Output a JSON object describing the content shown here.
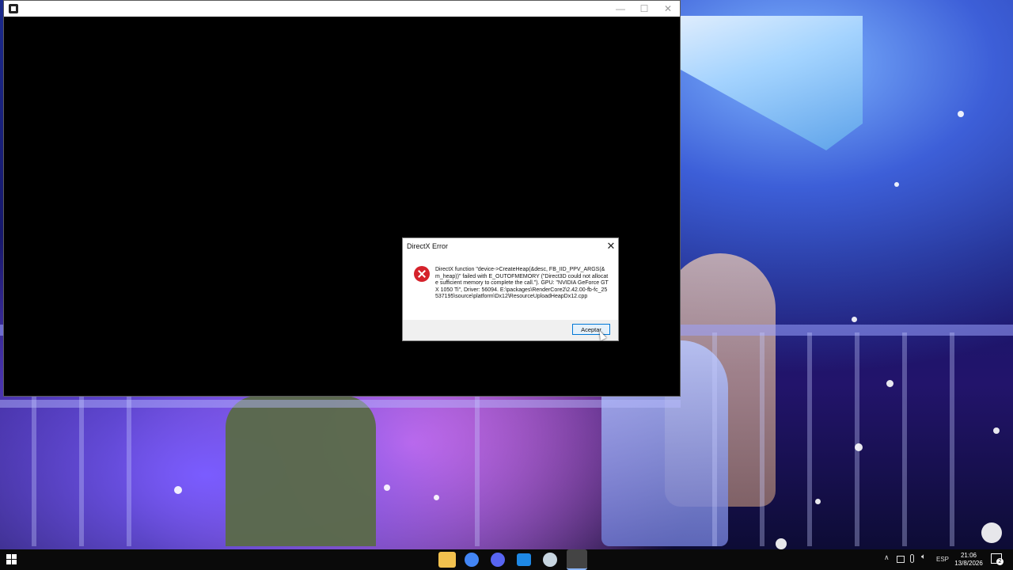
{
  "dialog": {
    "title": "DirectX Error",
    "close_glyph": "✕",
    "icon": "error-icon",
    "message": "DirectX function \"device->CreateHeap(&desc, FB_IID_PPV_ARGS(&m_heap))\" failed with E_OUTOFMEMORY (\"Direct3D could not allocate sufficient memory to complete the call.\"). GPU: \"NVIDIA GeForce GTX 1050 Ti\", Driver: 56094. E:\\packages\\RenderCore2\\2.42.00-fb-fc_25537195\\source\\platform\\Dx12\\ResourceUploadHeapDx12.cpp",
    "accept_label": "Aceptar"
  },
  "app_window": {
    "minimize_glyph": "—",
    "maximize_glyph": "☐",
    "close_glyph": "✕"
  },
  "taskbar": {
    "apps": [
      {
        "name": "file-explorer-icon",
        "color": "#f2c14e"
      },
      {
        "name": "chrome-icon",
        "color": "#4285f4"
      },
      {
        "name": "discord-icon",
        "color": "#5865f2"
      },
      {
        "name": "app-window-icon",
        "color": "#1e88e5"
      },
      {
        "name": "steam-icon",
        "color": "#c7d5e0"
      },
      {
        "name": "game-icon",
        "color": "#444444"
      }
    ],
    "tray": {
      "up_arrow": "∧",
      "language": "ESP",
      "time": "21:06",
      "date": "13/8/2026",
      "notifications_count": "2"
    }
  }
}
